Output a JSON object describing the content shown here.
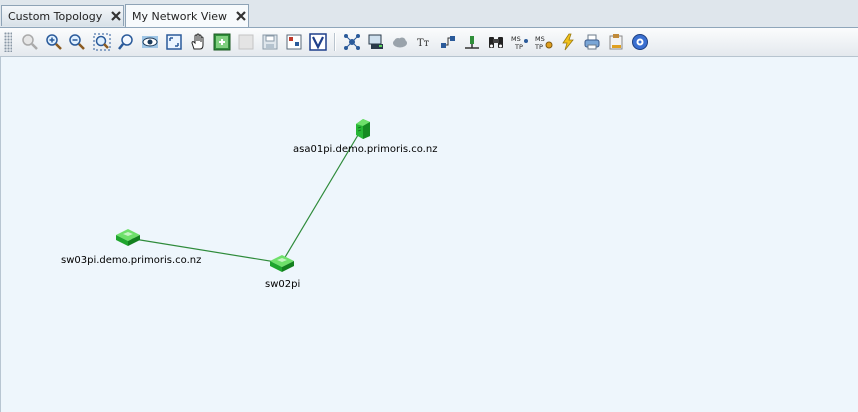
{
  "tabs": [
    {
      "label": "Custom Topology",
      "active": false
    },
    {
      "label": "My Network View",
      "active": true
    }
  ],
  "toolbar_icons": [
    "zoom-reset-icon",
    "zoom-in-icon",
    "zoom-out-icon",
    "zoom-fit-icon",
    "zoom-select-icon",
    "eye-view-icon",
    "fit-window-icon",
    "pan-hand-icon",
    "add-device-icon",
    "disabled-icon",
    "save-icon",
    "layout-icon",
    "visio-export-icon",
    "topology-icon",
    "print-device-icon",
    "cloud-icon",
    "text-tool-icon",
    "link-tool-icon",
    "network-node-icon",
    "binoculars-icon",
    "mstp-icon",
    "mstp-settings-icon",
    "lightning-icon",
    "printer-icon",
    "paste-icon",
    "settings-icon"
  ],
  "nodes": [
    {
      "id": "asa01pi",
      "label": "asa01pi.demo.primoris.co.nz",
      "type": "firewall"
    },
    {
      "id": "sw03pi",
      "label": "sw03pi.demo.primoris.co.nz",
      "type": "switch"
    },
    {
      "id": "sw02pi",
      "label": "sw02pi",
      "type": "switch"
    }
  ],
  "links": [
    {
      "from": "sw03pi",
      "to": "sw02pi"
    },
    {
      "from": "asa01pi",
      "to": "sw02pi"
    }
  ],
  "colors": {
    "link": "#2e8b3a",
    "device": "#22b533",
    "canvas": "#eef6fc"
  }
}
